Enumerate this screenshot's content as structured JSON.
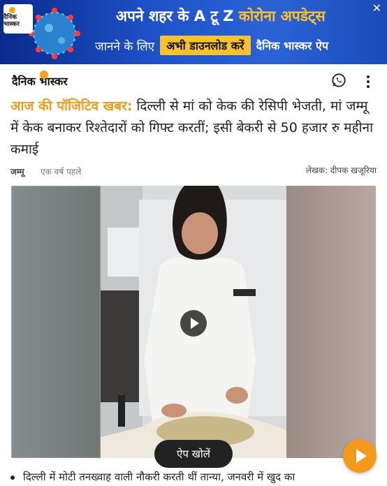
{
  "banner": {
    "logo_text": "दैनिक भास्कर",
    "line1_prefix": "अपने शहर के A टू Z",
    "line1_highlight": "कोरोना अपडेट्स",
    "line2_prefix": "जानने के लिए",
    "cta": "अभी डाउनलोड करें",
    "brand": "दैनिक भास्कर ऐप",
    "close": "✕"
  },
  "header": {
    "logo_text": "दैनिक भास्कर"
  },
  "article": {
    "tag": "आज की पॉजिटिव खबर:",
    "title": " दिल्ली से मां को केक की रेसिपी भेजती, मां जम्मू में केक बनाकर रिश्तेदारों को गिफ्ट करतीं; इसी बेकरी से 50 हजार रु महीना कमाई",
    "place": "जम्मू",
    "time": "एक वर्ष पहले",
    "author": "लेखक: दीपक खजूरिया",
    "bullet": "दिल्ली में मोटी तनख्वाह वाली नौकरी करती थीं तान्या, जनवरी में खुद का"
  },
  "actions": {
    "open_app": "ऐप खोलें"
  },
  "colors": {
    "accent": "#f39a1c",
    "banner_blue": "#1f52c9",
    "cta_yellow": "#f9c22c"
  }
}
